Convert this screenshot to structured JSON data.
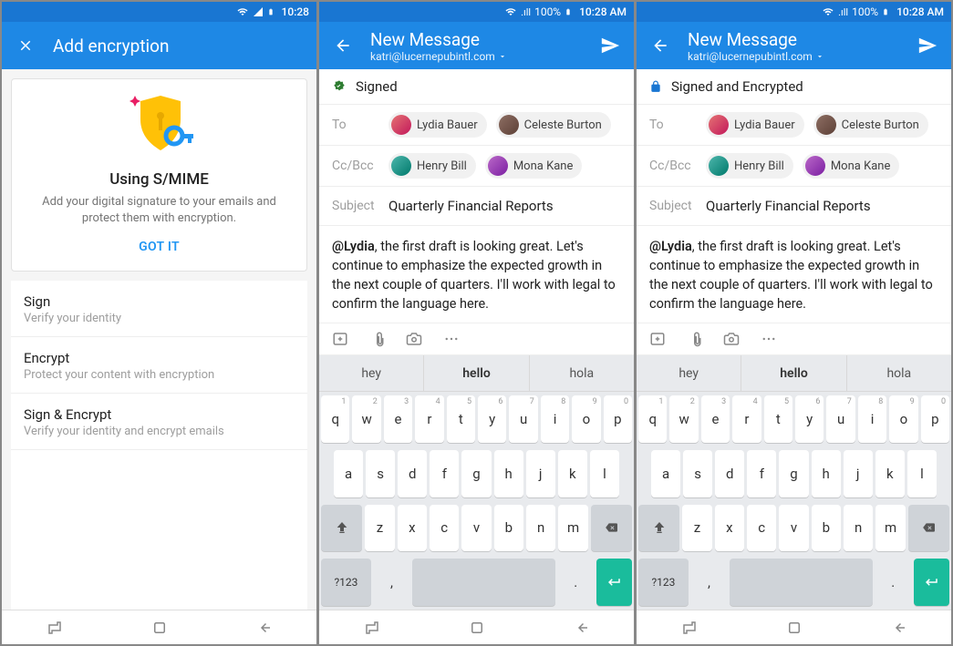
{
  "screen1": {
    "status": {
      "time": "10:28"
    },
    "appbar": {
      "title": "Add encryption"
    },
    "card": {
      "title": "Using S/MIME",
      "desc": "Add your digital signature to your emails and protect them with encryption.",
      "button": "GOT IT"
    },
    "options": [
      {
        "label": "Sign",
        "desc": "Verify your identity"
      },
      {
        "label": "Encrypt",
        "desc": "Protect your content with encryption"
      },
      {
        "label": "Sign & Encrypt",
        "desc": "Verify your identity and encrypt emails"
      }
    ]
  },
  "screen2": {
    "status": {
      "signal": "100%",
      "time": "10:28 AM"
    },
    "appbar": {
      "title": "New Message",
      "from": "katri@lucernepubintl.com"
    },
    "signed_label": "Signed",
    "fields": {
      "to_label": "To",
      "to": [
        {
          "name": "Lydia Bauer"
        },
        {
          "name": "Celeste Burton"
        }
      ],
      "cc_label": "Cc/Bcc",
      "cc": [
        {
          "name": "Henry Bill"
        },
        {
          "name": "Mona Kane"
        }
      ],
      "subject_label": "Subject",
      "subject_value": "Quarterly Financial Reports"
    },
    "body": {
      "mention": "@Lydia",
      "rest": ", the first draft is looking great. Let's continue to emphasize the expected growth in the next couple of quarters. I'll work with legal to confirm the language here."
    }
  },
  "screen3": {
    "status": {
      "signal": "100%",
      "time": "10:28 AM"
    },
    "appbar": {
      "title": "New Message",
      "from": "katri@lucernepubintl.com"
    },
    "signed_label": "Signed and Encrypted",
    "fields": {
      "to_label": "To",
      "to": [
        {
          "name": "Lydia Bauer"
        },
        {
          "name": "Celeste Burton"
        }
      ],
      "cc_label": "Cc/Bcc",
      "cc": [
        {
          "name": "Henry Bill"
        },
        {
          "name": "Mona Kane"
        }
      ],
      "subject_label": "Subject",
      "subject_value": "Quarterly Financial Reports"
    },
    "body": {
      "mention": "@Lydia",
      "rest": ", the first draft is looking great. Let's continue to emphasize the expected growth in the next couple of quarters. I'll work with legal to confirm the language here."
    }
  },
  "keyboard": {
    "suggestions": [
      "hey",
      "hello",
      "hola"
    ],
    "row1": [
      {
        "k": "q",
        "s": "1"
      },
      {
        "k": "w",
        "s": "2"
      },
      {
        "k": "e",
        "s": "3"
      },
      {
        "k": "r",
        "s": "4"
      },
      {
        "k": "t",
        "s": "5"
      },
      {
        "k": "y",
        "s": "6"
      },
      {
        "k": "u",
        "s": "7"
      },
      {
        "k": "i",
        "s": "8"
      },
      {
        "k": "o",
        "s": "9"
      },
      {
        "k": "p",
        "s": "0"
      }
    ],
    "row2": [
      "a",
      "s",
      "d",
      "f",
      "g",
      "h",
      "j",
      "k",
      "l"
    ],
    "row3": [
      "z",
      "x",
      "c",
      "v",
      "b",
      "n",
      "m"
    ],
    "sym_key": "?123",
    "comma": ",",
    "period": "."
  }
}
